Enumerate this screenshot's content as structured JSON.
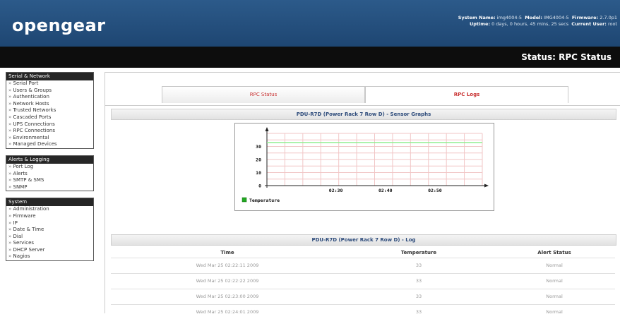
{
  "header": {
    "logo": "opengear",
    "system_line": [
      {
        "k": "System Name:",
        "v": "img4004-5"
      },
      {
        "k": "Model:",
        "v": "IMG4004-5"
      },
      {
        "k": "Firmware:",
        "v": "2.7.0p1"
      }
    ],
    "uptime_label": "Uptime:",
    "uptime_value": "0 days, 0 hours, 45 mins, 25 secs",
    "user_label": "Current User:",
    "user_value": "root",
    "page_title": "Status: RPC Status"
  },
  "sidebar": [
    {
      "title": "Serial & Network",
      "items": [
        "Serial Port",
        "Users & Groups",
        "Authentication",
        "Network Hosts",
        "Trusted Networks",
        "Cascaded Ports",
        "UPS Connections",
        "RPC Connections",
        "Environmental",
        "Managed Devices"
      ]
    },
    {
      "title": "Alerts & Logging",
      "items": [
        "Port Log",
        "Alerts",
        "SMTP & SMS",
        "SNMP"
      ]
    },
    {
      "title": "System",
      "items": [
        "Administration",
        "Firmware",
        "IP",
        "Date & Time",
        "Dial",
        "Services",
        "DHCP Server",
        "Nagios"
      ]
    }
  ],
  "tabs": [
    {
      "label": "RPC Status",
      "active": false
    },
    {
      "label": "RPC Logs",
      "active": true
    }
  ],
  "graph_section_title": "PDU-R7D (Power Rack 7 Row D) - Sensor Graphs",
  "chart_data": {
    "type": "line",
    "x": [
      "02:30",
      "02:40",
      "02:50"
    ],
    "series": [
      {
        "name": "Temperature",
        "values": [
          33,
          33,
          33,
          33
        ],
        "color": "#90ee90"
      }
    ],
    "y_ticks": [
      0,
      10,
      20,
      30
    ],
    "ylim": [
      0,
      40
    ],
    "grid": true
  },
  "log_section_title": "PDU-R7D (Power Rack 7 Row D) - Log",
  "log": {
    "columns": [
      "Time",
      "Temperature",
      "Alert Status"
    ],
    "rows": [
      [
        "Wed Mar 25 02:22:11 2009",
        "33",
        "Normal"
      ],
      [
        "Wed Mar 25 02:22:22 2009",
        "33",
        "Normal"
      ],
      [
        "Wed Mar 25 02:23:00 2009",
        "33",
        "Normal"
      ],
      [
        "Wed Mar 25 02:24:01 2009",
        "33",
        "Normal"
      ]
    ]
  }
}
